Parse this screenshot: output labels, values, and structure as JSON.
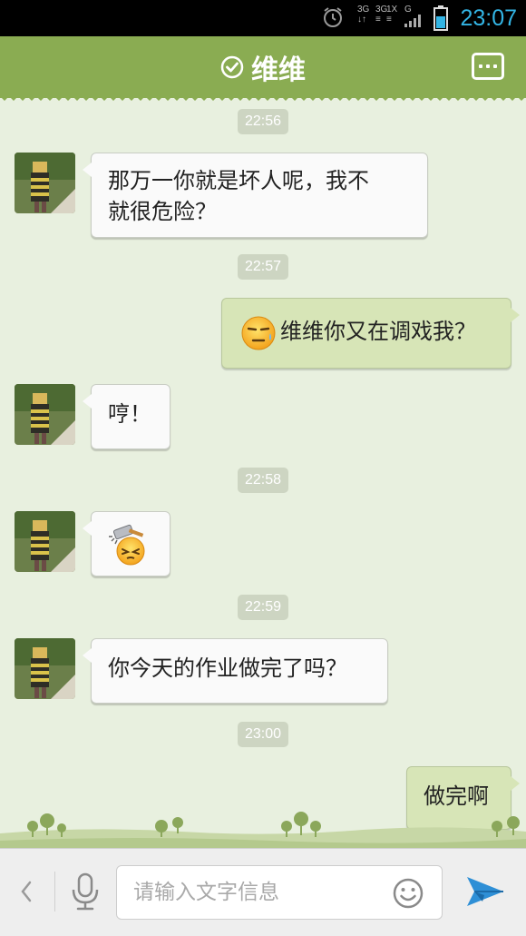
{
  "status_bar": {
    "time": "23:07",
    "network_1": "3G",
    "network_2": "3G",
    "network_3": "1X",
    "network_4": "G"
  },
  "header": {
    "title": "维维",
    "verified_icon": "check-circle-icon",
    "menu_icon": "more-icon"
  },
  "messages": [
    {
      "type": "timestamp",
      "text": "22:56"
    },
    {
      "type": "incoming",
      "text_line1": "那万一你就是坏人呢，我不",
      "text_line2": "就很危险？"
    },
    {
      "type": "timestamp",
      "text": "22:57"
    },
    {
      "type": "outgoing",
      "emoji": "sweat-face-emoji",
      "text": "维维你又在调戏我？"
    },
    {
      "type": "incoming",
      "text": "哼！"
    },
    {
      "type": "timestamp",
      "text": "22:58"
    },
    {
      "type": "incoming",
      "emoji": "hammer-head-emoji"
    },
    {
      "type": "timestamp",
      "text": "22:59"
    },
    {
      "type": "incoming",
      "text": "你今天的作业做完了吗？"
    },
    {
      "type": "timestamp",
      "text": "23:00"
    },
    {
      "type": "outgoing",
      "text": "做完啊"
    }
  ],
  "input_bar": {
    "placeholder": "请输入文字信息",
    "back_icon": "chevron-left-icon",
    "mic_icon": "microphone-icon",
    "emoji_icon": "smiley-icon",
    "send_icon": "send-arrow-icon"
  },
  "colors": {
    "header": "#8aac52",
    "chat_bg": "#e8f0df",
    "outgoing_bubble": "#d7e5b7",
    "incoming_bubble": "#fafafa",
    "accent_blue": "#33b5e5"
  }
}
